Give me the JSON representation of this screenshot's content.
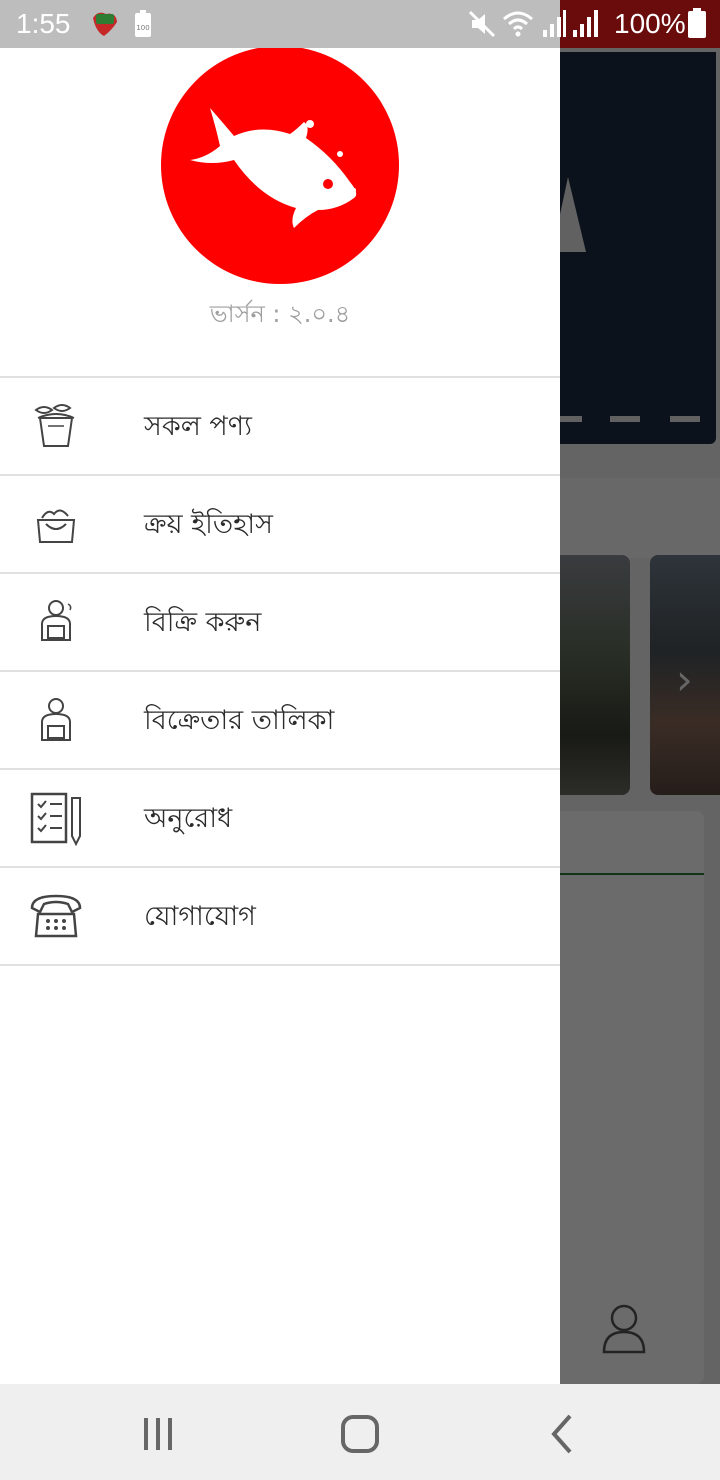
{
  "status_bar": {
    "time": "1:55",
    "battery_percent": "100%",
    "icons": [
      "notification-app-icon",
      "battery-saver-icon",
      "mute-icon",
      "wifi-icon",
      "signal-icon",
      "signal-icon-2",
      "battery-icon"
    ]
  },
  "drawer": {
    "logo": {
      "icon": "fish-logo-icon",
      "color": "#ff0000"
    },
    "version_label": "ভার্সন : ২.০.৪",
    "menu": [
      {
        "label": "সকল পণ্য",
        "icon": "fish-bucket-icon"
      },
      {
        "label": "ক্রয় ইতিহাস",
        "icon": "shopping-basket-icon"
      },
      {
        "label": "বিক্রি করুন",
        "icon": "fish-seller-icon"
      },
      {
        "label": "বিক্রেতার তালিকা",
        "icon": "seller-list-icon"
      },
      {
        "label": "অনুরোধ",
        "icon": "request-checklist-icon"
      },
      {
        "label": "যোগাযোগ",
        "icon": "telephone-icon"
      }
    ]
  },
  "nav_bar": {
    "buttons": [
      "recent-apps-icon",
      "home-icon",
      "back-icon"
    ]
  },
  "colors": {
    "accent": "#ff0000",
    "status_bar_right": "#6a0c0c",
    "divider": "#e0e0e0"
  }
}
